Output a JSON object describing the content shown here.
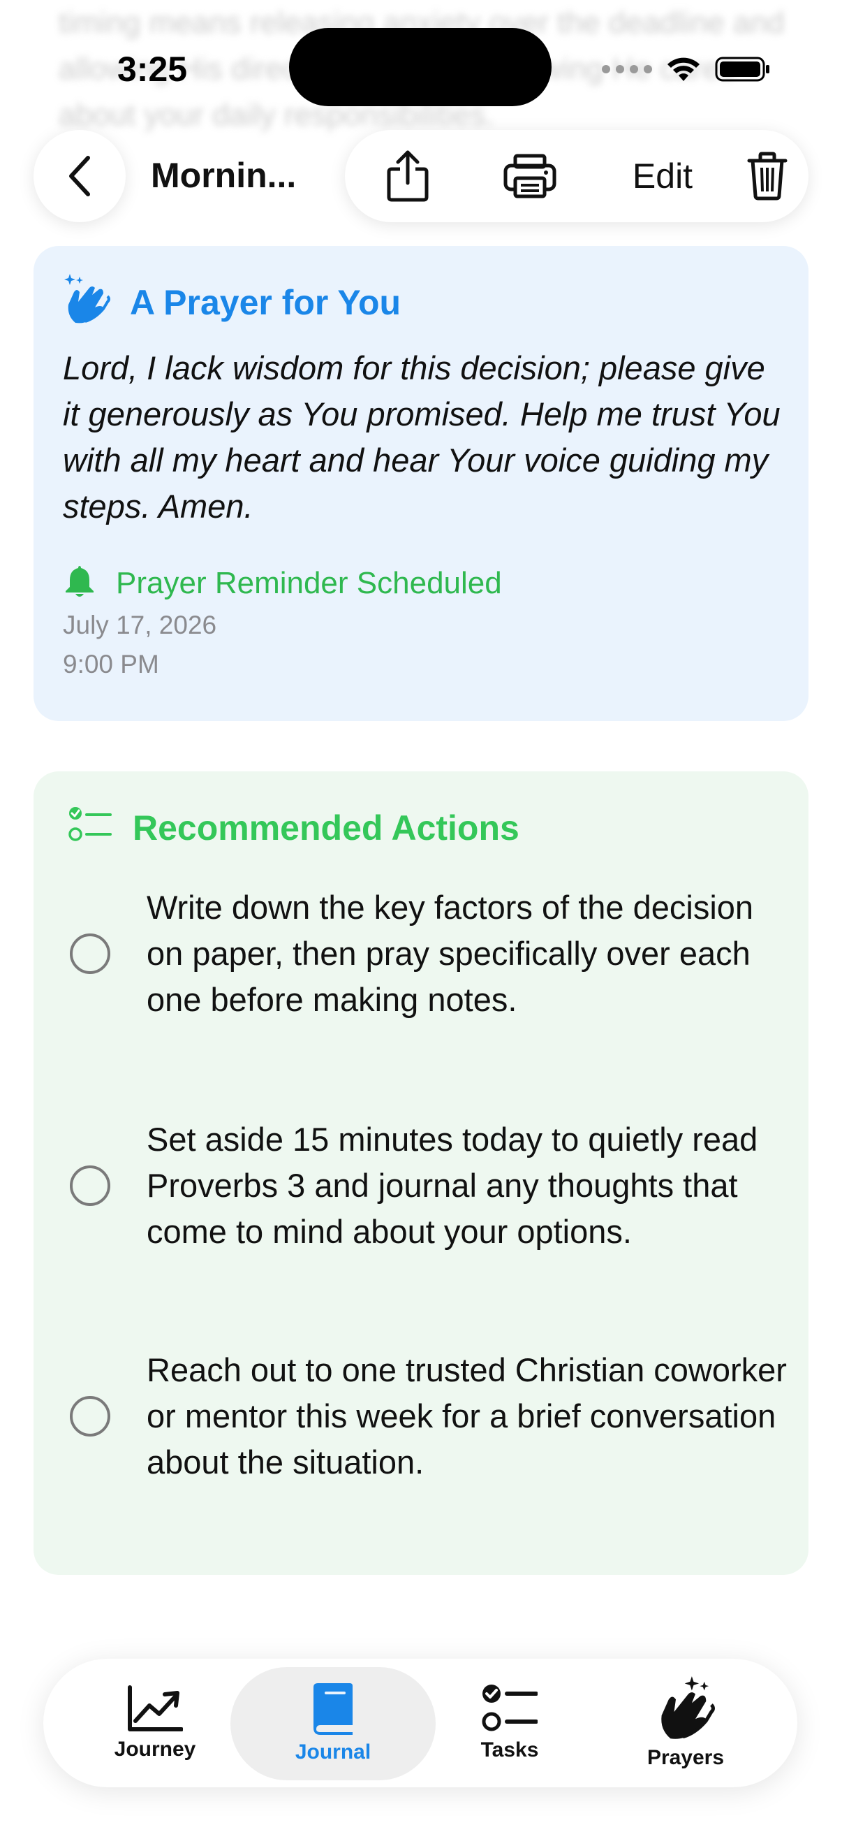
{
  "background_text": "timing means releasing anxiety over the deadline and allowing His direction to unfold, knowing He cares about your daily responsibilities.",
  "status_bar": {
    "time": "3:25"
  },
  "nav": {
    "title": "Mornin...",
    "edit_label": "Edit"
  },
  "prayer_card": {
    "title": "A Prayer for You",
    "text": "Lord, I lack wisdom for this decision; please give it generously as You promised. Help me trust You with all my heart and hear Your voice guiding my steps. Amen.",
    "reminder_label": "Prayer Reminder Scheduled",
    "reminder_date": "July 17, 2026",
    "reminder_time": "9:00 PM",
    "accent": "#1a86e8",
    "reminder_color": "#2fb84f"
  },
  "actions_card": {
    "title": "Recommended Actions",
    "accent": "#34c759",
    "items": [
      {
        "text": "Write down the key factors of the decision on paper, then pray specifically over each one before making notes."
      },
      {
        "text": "Set aside 15 minutes today to quietly read Proverbs 3 and journal any thoughts that come to mind about your options."
      },
      {
        "text": "Reach out to one trusted Christian coworker or mentor this week for a brief conversation about the situation."
      }
    ]
  },
  "tabbar": {
    "active": "Journal",
    "tabs": [
      {
        "label": "Journey",
        "icon": "chart-line-icon"
      },
      {
        "label": "Journal",
        "icon": "book-icon"
      },
      {
        "label": "Tasks",
        "icon": "checklist-icon"
      },
      {
        "label": "Prayers",
        "icon": "praying-hands-icon"
      }
    ]
  }
}
